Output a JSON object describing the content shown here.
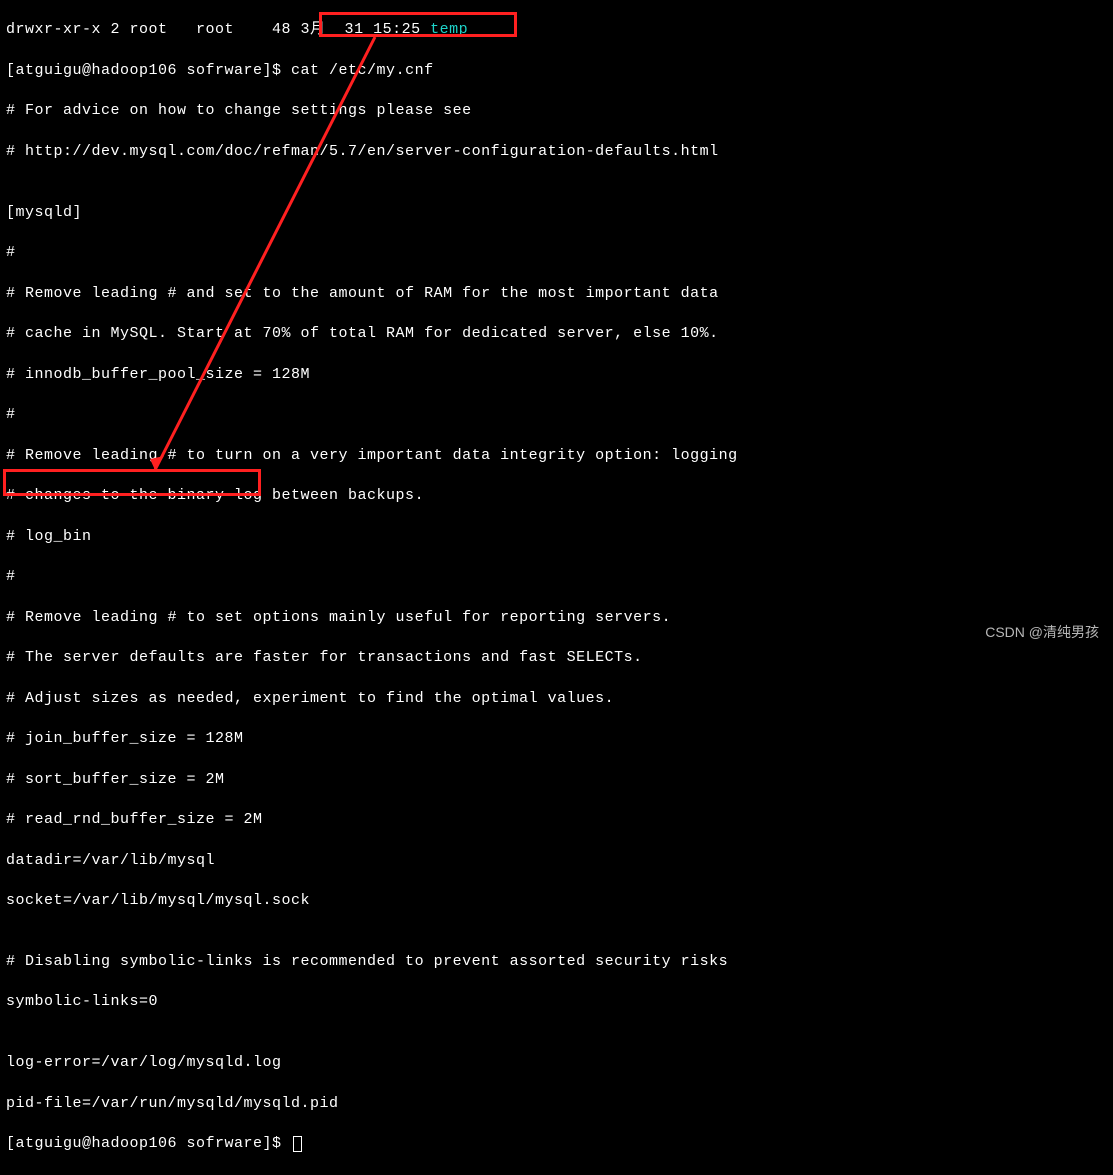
{
  "top_partial_line": {
    "perm": "drwxr-xr-x 2 root   root",
    "mid": "    48 3月  31 15:25 ",
    "name": "temp"
  },
  "prompt1": {
    "user_host": "[atguigu@hadoop106 sofrware]$ ",
    "command": "cat /etc/my.cnf"
  },
  "file_lines": [
    "# For advice on how to change settings please see",
    "# http://dev.mysql.com/doc/refman/5.7/en/server-configuration-defaults.html",
    "",
    "[mysqld]",
    "#",
    "# Remove leading # and set to the amount of RAM for the most important data",
    "# cache in MySQL. Start at 70% of total RAM for dedicated server, else 10%.",
    "# innodb_buffer_pool_size = 128M",
    "#",
    "# Remove leading # to turn on a very important data integrity option: logging",
    "# changes to the binary log between backups.",
    "# log_bin",
    "#",
    "# Remove leading # to set options mainly useful for reporting servers.",
    "# The server defaults are faster for transactions and fast SELECTs.",
    "# Adjust sizes as needed, experiment to find the optimal values.",
    "# join_buffer_size = 128M",
    "# sort_buffer_size = 2M",
    "# read_rnd_buffer_size = 2M",
    "datadir=/var/lib/mysql",
    "socket=/var/lib/mysql/mysql.sock",
    "",
    "# Disabling symbolic-links is recommended to prevent assorted security risks",
    "symbolic-links=0",
    "",
    "log-error=/var/log/mysqld.log",
    "pid-file=/var/run/mysqld/mysqld.pid"
  ],
  "prompt2": {
    "user_host": "[atguigu@hadoop106 sofrware]$ "
  },
  "watermark": "CSDN @清纯男孩"
}
